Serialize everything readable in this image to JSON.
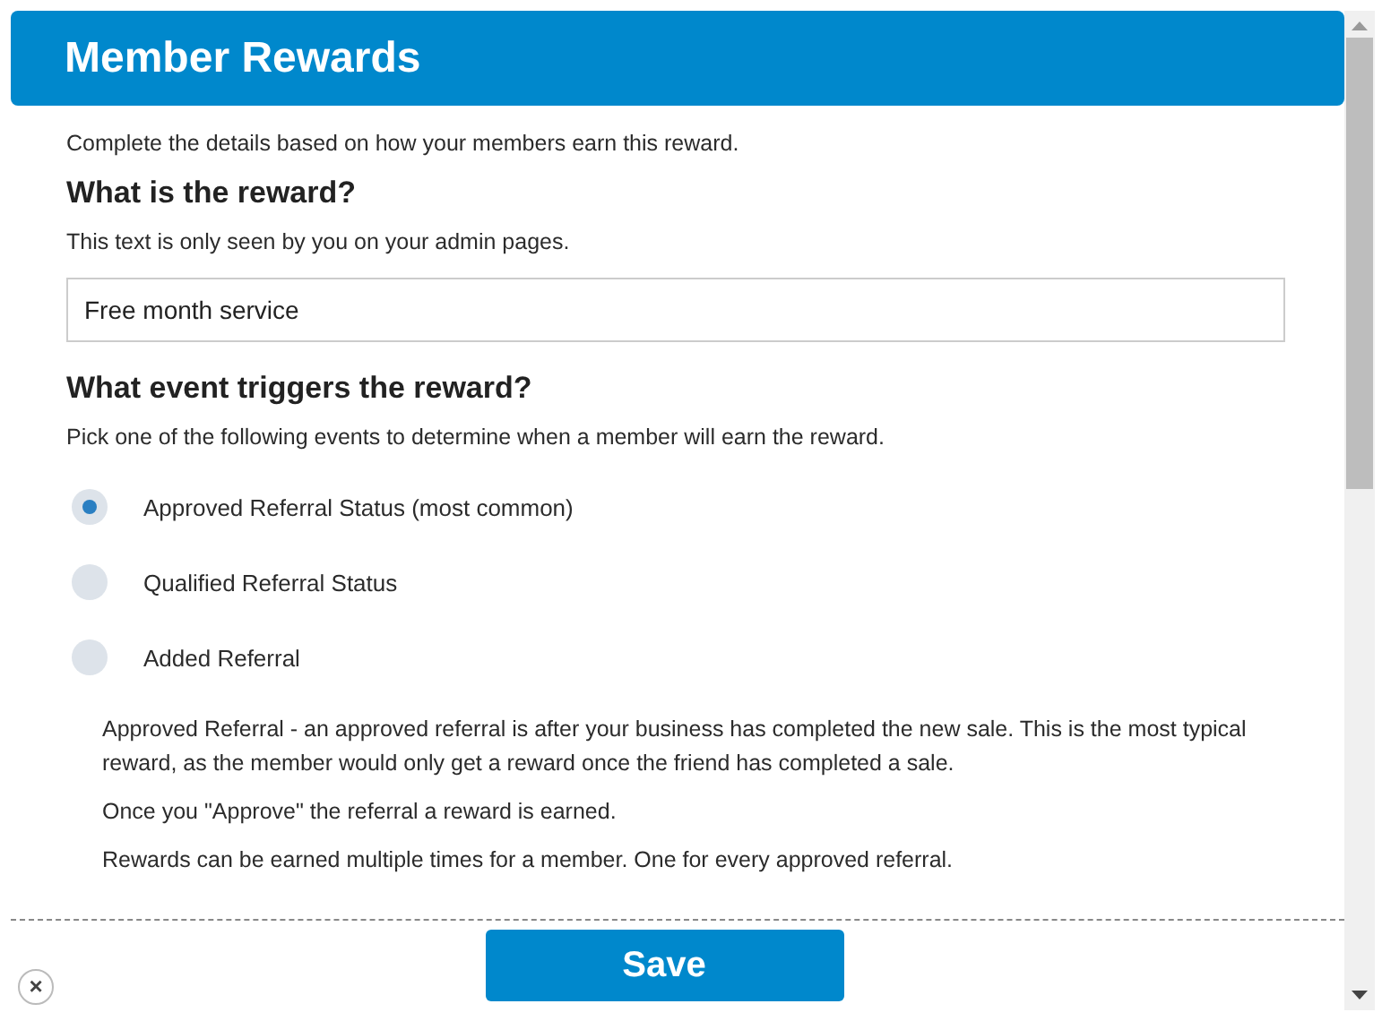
{
  "header": {
    "title": "Member Rewards"
  },
  "intro": "Complete the details based on how your members earn this reward.",
  "reward": {
    "heading": "What is the reward?",
    "hint": "This text is only seen by you on your admin pages.",
    "value": "Free month service"
  },
  "trigger": {
    "heading": "What event triggers the reward?",
    "hint": "Pick one of the following events to determine when a member will earn the reward.",
    "options": [
      {
        "label": "Approved Referral Status (most common)",
        "selected": true
      },
      {
        "label": "Qualified Referral Status",
        "selected": false
      },
      {
        "label": "Added Referral",
        "selected": false
      }
    ],
    "notes": [
      "Approved Referral - an approved referral is after your business has completed the new sale. This is the most typical reward, as the member would only get a reward once the friend has completed a sale.",
      "Once you \"Approve\" the referral a reward is earned.",
      "Rewards can be earned multiple times for a member. One for every approved referral."
    ]
  },
  "footer": {
    "save": "Save",
    "close": "×"
  }
}
